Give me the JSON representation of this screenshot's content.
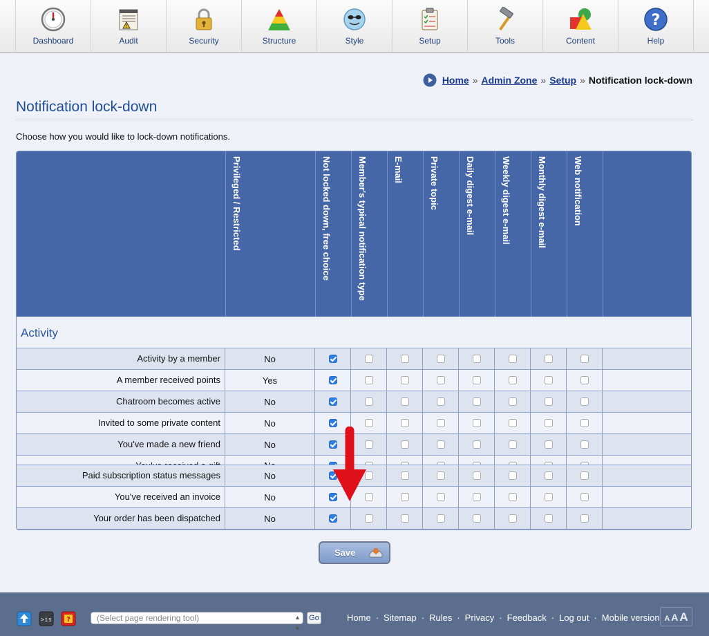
{
  "nav": {
    "items": [
      {
        "label": "Dashboard",
        "icon": "dashboard-gauge-icon"
      },
      {
        "label": "Audit",
        "icon": "audit-report-icon"
      },
      {
        "label": "Security",
        "icon": "padlock-icon"
      },
      {
        "label": "Structure",
        "icon": "structure-pyramid-icon"
      },
      {
        "label": "Style",
        "icon": "style-face-icon"
      },
      {
        "label": "Setup",
        "icon": "setup-clipboard-icon"
      },
      {
        "label": "Tools",
        "icon": "hammer-icon"
      },
      {
        "label": "Content",
        "icon": "content-shapes-icon"
      },
      {
        "label": "Help",
        "icon": "help-question-icon"
      }
    ]
  },
  "breadcrumb": {
    "home": "Home",
    "admin_zone": "Admin Zone",
    "setup": "Setup",
    "separator": "»",
    "current": "Notification lock-down"
  },
  "page": {
    "title": "Notification lock-down",
    "intro": "Choose how you would like to lock-down notifications."
  },
  "table": {
    "columns": [
      "Privileged / Restricted",
      "Not locked down, free choice",
      "Member's typical notification type",
      "E-mail",
      "Private topic",
      "Daily digest e-mail",
      "Weekly digest e-mail",
      "Monthly digest e-mail",
      "Web notification"
    ],
    "section": "Activity",
    "rows": [
      {
        "label": "Activity by a member",
        "privileged": "No",
        "checks": [
          true,
          false,
          false,
          false,
          false,
          false,
          false,
          false
        ]
      },
      {
        "label": "A member received points",
        "privileged": "Yes",
        "checks": [
          true,
          false,
          false,
          false,
          false,
          false,
          false,
          false
        ]
      },
      {
        "label": "Chatroom becomes active",
        "privileged": "No",
        "checks": [
          true,
          false,
          false,
          false,
          false,
          false,
          false,
          false
        ]
      },
      {
        "label": "Invited to some private content",
        "privileged": "No",
        "checks": [
          true,
          false,
          false,
          false,
          false,
          false,
          false,
          false
        ]
      },
      {
        "label": "You've made a new friend",
        "privileged": "No",
        "checks": [
          true,
          false,
          false,
          false,
          false,
          false,
          false,
          false
        ]
      },
      {
        "label": "You've received a gift",
        "privileged": "No",
        "checks": [
          true,
          false,
          false,
          false,
          false,
          false,
          false,
          false
        ],
        "partial": true
      },
      {
        "label": "Paid subscription status messages",
        "privileged": "No",
        "checks": [
          true,
          false,
          false,
          false,
          false,
          false,
          false,
          false
        ]
      },
      {
        "label": "You've received an invoice",
        "privileged": "No",
        "checks": [
          true,
          false,
          false,
          false,
          false,
          false,
          false,
          false
        ]
      },
      {
        "label": "Your order has been dispatched",
        "privileged": "No",
        "checks": [
          true,
          false,
          false,
          false,
          false,
          false,
          false,
          false
        ]
      }
    ]
  },
  "save_button": {
    "label": "Save",
    "icon": "save-tray-icon"
  },
  "footer": {
    "icons": [
      "upload-arrow-icon",
      "xml-terminal-icon",
      "help-bug-icon"
    ],
    "select_placeholder": "(Select page rendering tool)",
    "go_label": "Go",
    "links": [
      "Home",
      "Sitemap",
      "Rules",
      "Privacy",
      "Feedback",
      "Log out",
      "Mobile version"
    ],
    "link_separator": "·",
    "text_size": [
      "A",
      "A",
      "A"
    ]
  },
  "colors": {
    "header_blue": "#4567a8",
    "title_blue": "#1f4e96",
    "checkbox_checked": "#2f7de1",
    "footer_bg": "#5b6e8e",
    "arrow_red": "#e0101b"
  }
}
